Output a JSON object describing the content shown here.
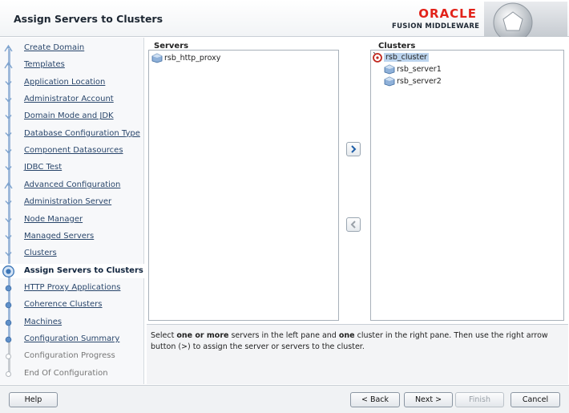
{
  "header": {
    "title": "Assign Servers to Clusters",
    "brand": "ORACLE",
    "brand_sub": "FUSION MIDDLEWARE",
    "brand_color": "#e2231a"
  },
  "sidebar": {
    "items": [
      {
        "label": "Create Domain",
        "state": "done"
      },
      {
        "label": "Templates",
        "state": "done"
      },
      {
        "label": "Application Location",
        "state": "done"
      },
      {
        "label": "Administrator Account",
        "state": "done"
      },
      {
        "label": "Domain Mode and JDK",
        "state": "done"
      },
      {
        "label": "Database Configuration Type",
        "state": "done"
      },
      {
        "label": "Component Datasources",
        "state": "done"
      },
      {
        "label": "JDBC Test",
        "state": "done"
      },
      {
        "label": "Advanced Configuration",
        "state": "done"
      },
      {
        "label": "Administration Server",
        "state": "done"
      },
      {
        "label": "Node Manager",
        "state": "done"
      },
      {
        "label": "Managed Servers",
        "state": "done"
      },
      {
        "label": "Clusters",
        "state": "done"
      },
      {
        "label": "Assign Servers to Clusters",
        "state": "current"
      },
      {
        "label": "HTTP Proxy Applications",
        "state": "next"
      },
      {
        "label": "Coherence Clusters",
        "state": "next"
      },
      {
        "label": "Machines",
        "state": "next"
      },
      {
        "label": "Configuration Summary",
        "state": "next"
      },
      {
        "label": "Configuration Progress",
        "state": "future"
      },
      {
        "label": "End Of Configuration",
        "state": "future"
      }
    ]
  },
  "servers": {
    "title": "Servers",
    "items": [
      "rsb_http_proxy"
    ]
  },
  "clusters": {
    "title": "Clusters",
    "cluster": "rsb_cluster",
    "members": [
      "rsb_server1",
      "rsb_server2"
    ]
  },
  "help": {
    "p1": "Select ",
    "b1": "one or more",
    "p2": " servers in the left pane and ",
    "b2": "one",
    "p3": " cluster in the right pane. Then use the right arrow button (>) to assign the server or servers to the cluster."
  },
  "footer": {
    "help": "Help",
    "back": "< Back",
    "next": "Next >",
    "finish": "Finish",
    "cancel": "Cancel"
  }
}
